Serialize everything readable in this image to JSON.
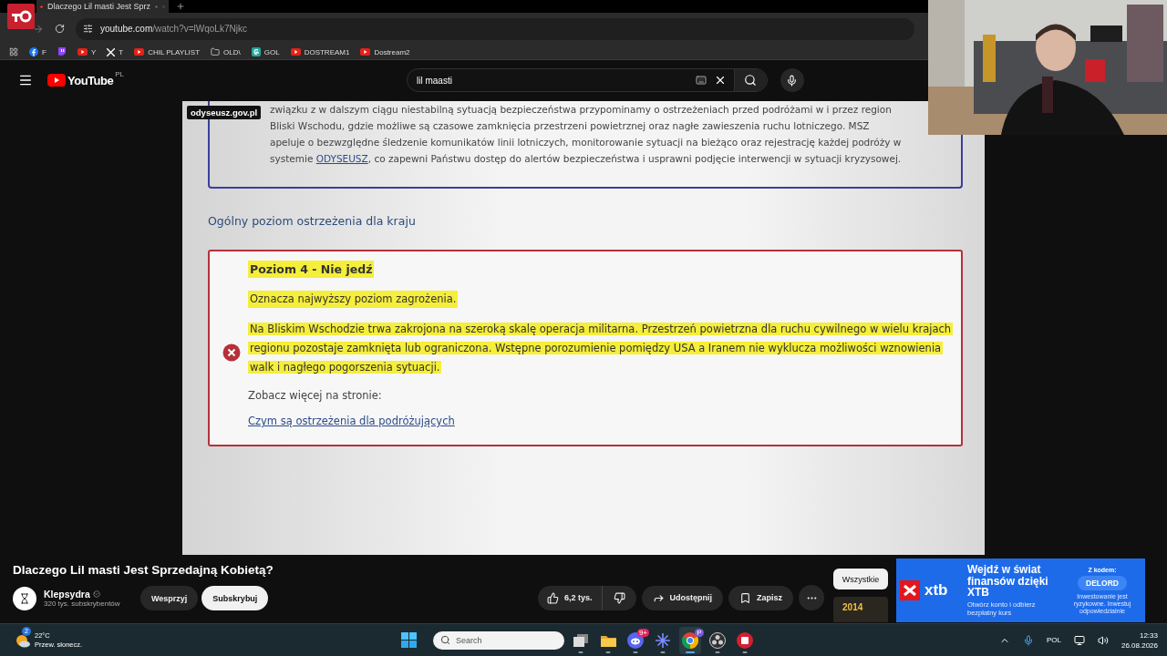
{
  "browser": {
    "tab_title": "Dlaczego Lil masti Jest Sprz",
    "url_host": "youtube.com",
    "url_path": "/watch?v=lWqoLk7Njkc",
    "bookmarks": [
      {
        "kind": "facebook",
        "label": "F"
      },
      {
        "kind": "twitch"
      },
      {
        "kind": "youtube",
        "label": "Y"
      },
      {
        "kind": "x",
        "label": "T"
      },
      {
        "kind": "youtube",
        "label": "CHIL PLAYLIST"
      },
      {
        "kind": "folder",
        "label": "OLD\\"
      },
      {
        "kind": "g",
        "label": "GOL"
      },
      {
        "kind": "youtube",
        "label": "DOSTREAM1"
      },
      {
        "kind": "youtube",
        "label": "Dostream2"
      }
    ]
  },
  "youtube": {
    "logo_text": "YouTube",
    "region": "PL",
    "search": "lil maasti"
  },
  "video": {
    "source_label": "odyseusz.gov.pl",
    "notice": {
      "before": "związku z w dalszym ciągu niestabilną sytuacją bezpieczeństwa przypominamy o ostrzeżeniach przed podróżami w i przez region Bliski Wschodu, gdzie możliwe są czasowe zamknięcia przestrzeni powietrznej oraz nagłe zawieszenia ruchu lotniczego. MSZ apeluje o bezwzględne śledzenie komunikatów linii lotniczych, monitorowanie sytuacji na bieżąco oraz rejestrację każdej podróży w systemie ",
      "link": "ODYSEUSZ",
      "after": ", co zapewni Państwu dostęp do alertów bezpieczeństwa i usprawni podjęcie interwencji w sytuacji kryzysowej."
    },
    "section_heading": "Ogólny poziom ostrzeżenia dla kraju",
    "warning": {
      "title": "Poziom 4 - Nie jedź",
      "summary": "Oznacza najwyższy poziom zagrożenia.",
      "details": "Na Bliskim Wschodzie trwa zakrojona na szeroką skalę operacja militarna. Przestrzeń powietrzna dla ruchu cywilnego w wielu krajach regionu pozostaje zamknięta lub ograniczona. Wstępne porozumienie pomiędzy USA a Iranem nie wyklucza możliwości wznowienia walk i nagłego pogorszenia sytuacji.",
      "more_label": "Zobacz więcej na stronie:",
      "more_link": "Czym są ostrzeżenia dla podróżujących"
    }
  },
  "title": "Dlaczego Lil masti Jest Sprzedajną Kobietą?",
  "channel": {
    "name": "Klepsydra",
    "subscribers": "320 tys. subskrybentów"
  },
  "channel_buttons": [
    {
      "kind": "support",
      "label": "Wesprzyj"
    },
    {
      "kind": "subscribe",
      "label": "Subskrybuj"
    }
  ],
  "actions": {
    "likes": "6,2 tys.",
    "share": "Udostępnij",
    "save": "Zapisz"
  },
  "chips": [
    {
      "label": "Wszystkie",
      "selected": true
    }
  ],
  "ad": {
    "brand": "xtb",
    "headline": "Wejdź w świat finansów dzięki XTB",
    "sub": "Otwórz konto i odbierz bezpłatny kurs",
    "code_label": "Z kodem:",
    "code": "DELORD",
    "disclaimer": "Inwestowanie jest ryzykowne. Inwestuj odpowiedzialnie"
  },
  "thumbnail_label": "2014",
  "taskbar": {
    "temperature": "22°C",
    "weather": "Przew. słonecz.",
    "weather_badge": "2",
    "search_placeholder": "Search",
    "apps": [
      {
        "kind": "windows",
        "active": false
      },
      {
        "kind": "folder",
        "active": false
      },
      {
        "kind": "discord",
        "badge": "9+",
        "active": false
      },
      {
        "kind": "sparkle",
        "active": false
      },
      {
        "kind": "chrome",
        "badge": "P",
        "active": true
      },
      {
        "kind": "obs",
        "active": false
      },
      {
        "kind": "red",
        "active": false
      }
    ],
    "language": "POL",
    "time": "12:33",
    "date": "26.08.2026"
  }
}
